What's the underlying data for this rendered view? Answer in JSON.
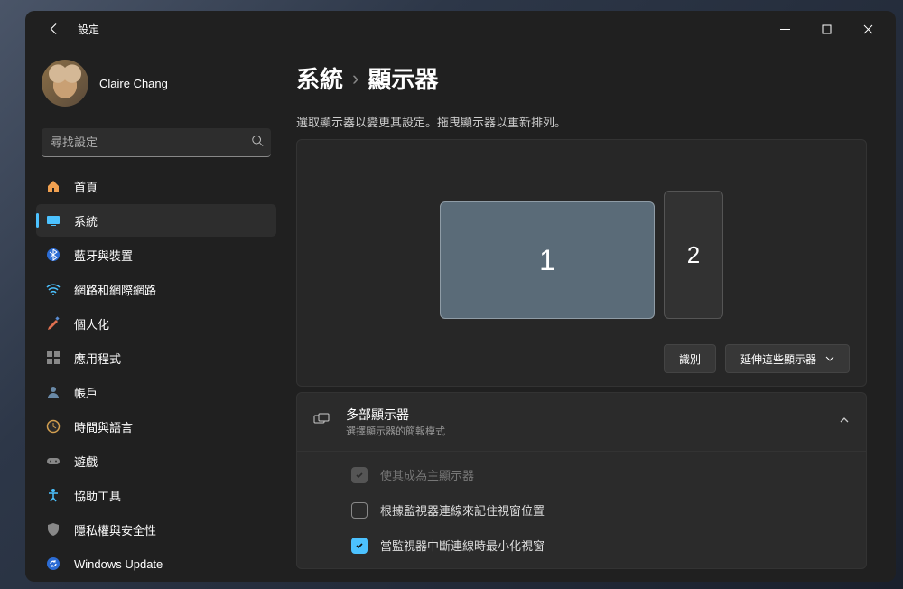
{
  "titlebar": {
    "app": "設定"
  },
  "profile": {
    "name": "Claire Chang",
    "sub": " "
  },
  "search": {
    "placeholder": "尋找設定"
  },
  "sidebar": {
    "items": [
      {
        "label": "首頁"
      },
      {
        "label": "系統"
      },
      {
        "label": "藍牙與裝置"
      },
      {
        "label": "網路和網際網路"
      },
      {
        "label": "個人化"
      },
      {
        "label": "應用程式"
      },
      {
        "label": "帳戶"
      },
      {
        "label": "時間與語言"
      },
      {
        "label": "遊戲"
      },
      {
        "label": "協助工具"
      },
      {
        "label": "隱私權與安全性"
      },
      {
        "label": "Windows Update"
      }
    ]
  },
  "breadcrumb": {
    "parent": "系統",
    "current": "顯示器"
  },
  "hint": "選取顯示器以變更其設定。拖曳顯示器以重新排列。",
  "monitors": {
    "m1": "1",
    "m2": "2"
  },
  "actions": {
    "identify": "識別",
    "mode": "延伸這些顯示器"
  },
  "multi": {
    "title": "多部顯示器",
    "sub": "選擇顯示器的簡報模式",
    "opt1": "使其成為主顯示器",
    "opt2": "根據監視器連線來記住視窗位置",
    "opt3": "當監視器中斷連線時最小化視窗"
  }
}
